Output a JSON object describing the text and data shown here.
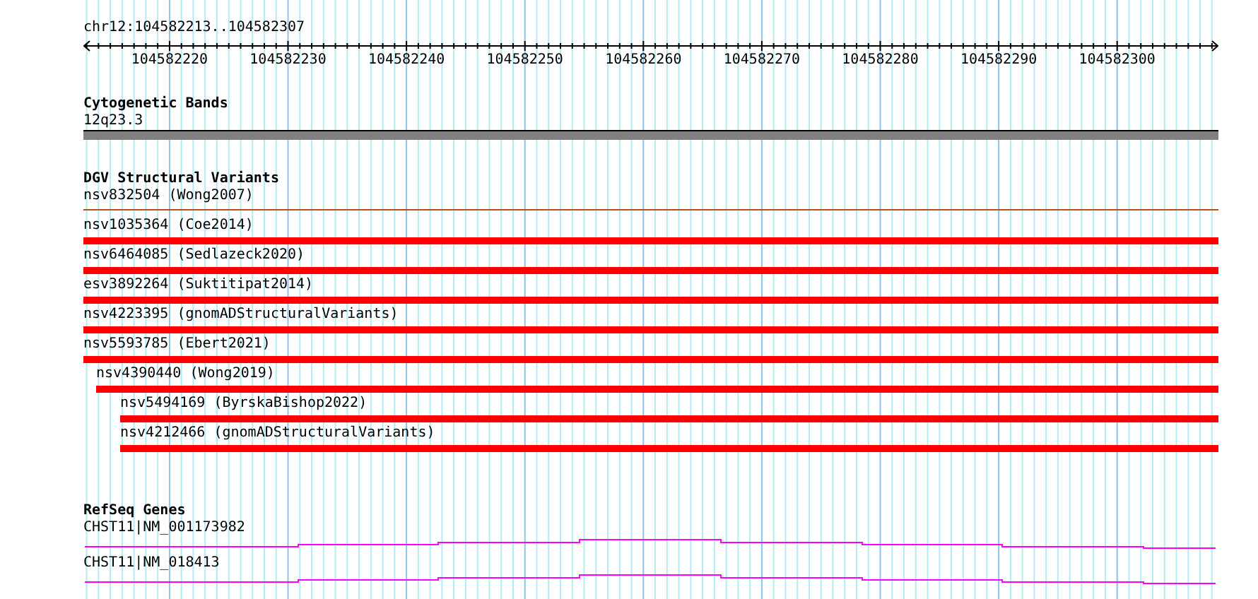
{
  "location": "chr12:104582213..104582307",
  "ruler": {
    "ticks": [
      "104582220",
      "104582230",
      "104582240",
      "104582250",
      "104582260",
      "104582270",
      "104582280",
      "104582290",
      "104582300"
    ]
  },
  "cytobands": {
    "title": "Cytogenetic Bands",
    "band": "12q23.3"
  },
  "variants": {
    "title": "DGV Structural Variants",
    "rows": [
      {
        "label": "nsv832504 (Wong2007)",
        "kind": "line",
        "color": "#b0501a"
      },
      {
        "label": "nsv1035364 (Coe2014)",
        "kind": "bar",
        "color": "#ff0000"
      },
      {
        "label": "nsv6464085 (Sedlazeck2020)",
        "kind": "bar",
        "color": "#ff0000"
      },
      {
        "label": "esv3892264 (Suktitipat2014)",
        "kind": "bar",
        "color": "#ff0000"
      },
      {
        "label": "nsv4223395 (gnomADStructuralVariants)",
        "kind": "bar",
        "color": "#ff0000"
      },
      {
        "label": "nsv5593785 (Ebert2021)",
        "kind": "bar",
        "color": "#ff0000",
        "children": [
          {
            "label": "nsv4390440 (Wong2019)",
            "kind": "bar",
            "color": "#ff0000",
            "children": [
              {
                "label": "nsv5494169 (ByrskaBishop2022)",
                "kind": "bar",
                "color": "#ff0000"
              },
              {
                "label": "nsv4212466 (gnomADStructuralVariants)",
                "kind": "bar",
                "color": "#ff0000"
              }
            ]
          }
        ]
      }
    ]
  },
  "genes": {
    "title": "RefSeq Genes",
    "rows": [
      {
        "label": "CHST11|NM_001173982"
      },
      {
        "label": "CHST11|NM_018413"
      }
    ]
  }
}
